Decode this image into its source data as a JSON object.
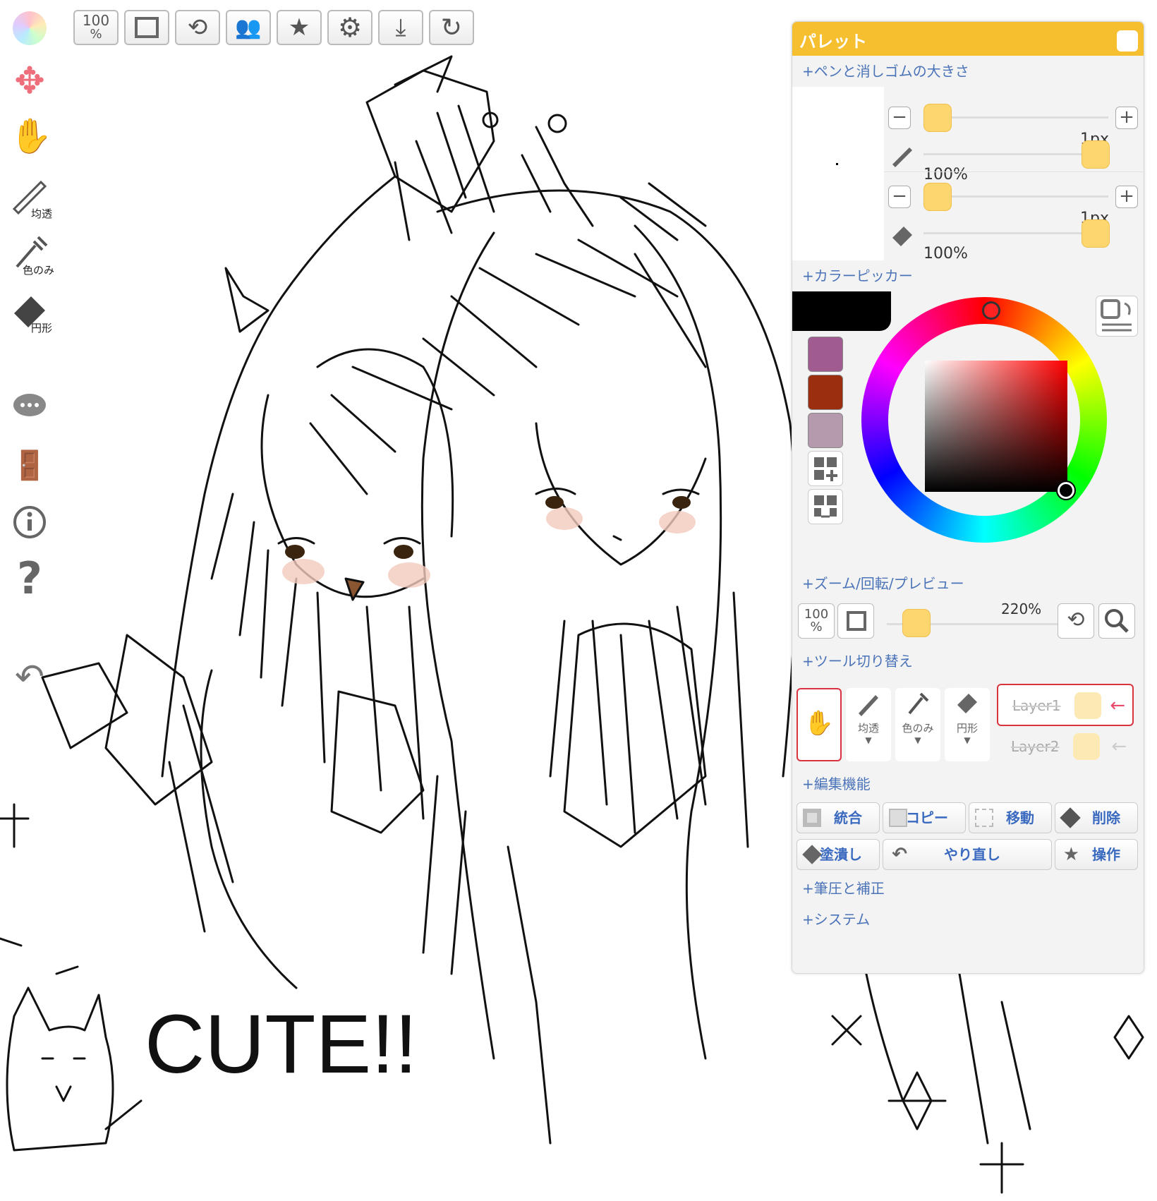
{
  "toolbar": {
    "zoom_label": "100",
    "zoom_unit": "%"
  },
  "left_tools": {
    "pen_label": "均透",
    "dropper_label": "色のみ",
    "eraser_label": "円形"
  },
  "palette": {
    "title": "パレット",
    "pen_eraser_section": "+ペンと消しゴムの大きさ",
    "pen_size": "1px",
    "pen_opacity": "100%",
    "eraser_size": "1px",
    "eraser_opacity": "100%",
    "color_picker_section": "+カラーピッカー",
    "current_color": "#000000",
    "swatches": [
      "#a05c91",
      "#9a2e0e",
      "#b49aac"
    ],
    "zoom_section": "+ズーム/回転/プレビュー",
    "zoom_btn_label": "100",
    "zoom_btn_unit": "%",
    "zoom_value": "220%",
    "tool_switch_section": "+ツール切り替え",
    "tools": [
      {
        "label": ""
      },
      {
        "label": "均透"
      },
      {
        "label": "色のみ"
      },
      {
        "label": "円形"
      }
    ],
    "layers": [
      {
        "label": "Layer1",
        "active": true
      },
      {
        "label": "Layer2",
        "active": false
      }
    ],
    "edit_section": "+編集機能",
    "edit_buttons": {
      "merge": "統合",
      "copy": "コピー",
      "move": "移動",
      "delete": "削除",
      "fill": "塗潰し",
      "redo": "やり直し",
      "action": "操作"
    },
    "pressure_section": "+筆圧と補正",
    "system_section": "+システム"
  },
  "canvas_text": {
    "cute": "CUTE!!"
  },
  "colors": {
    "accent": "#f6bf2f",
    "link": "#4b73b8",
    "knob": "#fdd66f",
    "active_border": "#d9333f"
  }
}
